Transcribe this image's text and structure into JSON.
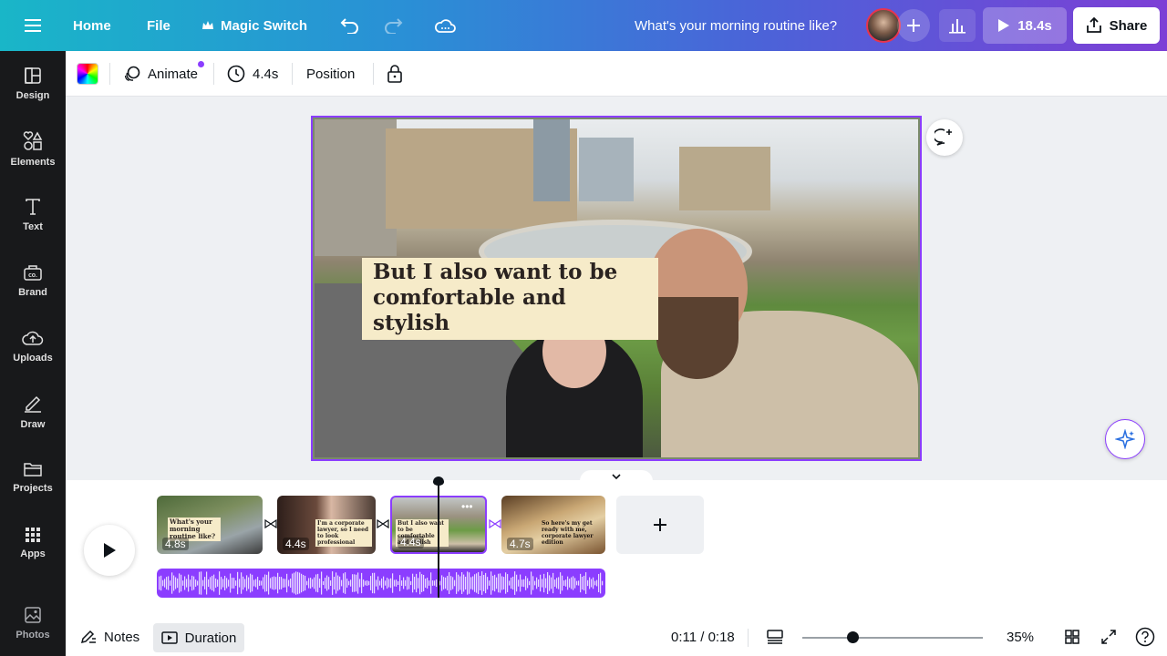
{
  "topbar": {
    "home": "Home",
    "file": "File",
    "magic_switch": "Magic Switch",
    "title": "What's your morning routine like?",
    "play_duration": "18.4s",
    "share": "Share"
  },
  "sidebar": {
    "items": [
      {
        "label": "Design",
        "icon": "design-icon"
      },
      {
        "label": "Elements",
        "icon": "elements-icon"
      },
      {
        "label": "Text",
        "icon": "text-icon"
      },
      {
        "label": "Brand",
        "icon": "brand-icon"
      },
      {
        "label": "Uploads",
        "icon": "upload-icon"
      },
      {
        "label": "Draw",
        "icon": "draw-icon"
      },
      {
        "label": "Projects",
        "icon": "folder-icon"
      },
      {
        "label": "Apps",
        "icon": "apps-icon"
      },
      {
        "label": "Photos",
        "icon": "photo-icon"
      }
    ]
  },
  "toolbar": {
    "animate": "Animate",
    "duration": "4.4s",
    "position": "Position"
  },
  "canvas": {
    "caption_line1": "But I also want to be",
    "caption_line2": "comfortable and stylish"
  },
  "timeline": {
    "clips": [
      {
        "duration": "4.8s",
        "text": "What's your morning routine like?"
      },
      {
        "duration": "4.4s",
        "text": "I'm a corporate lawyer, so I need to look professional"
      },
      {
        "duration": "4.4s",
        "text": "But I also want to be comfortable and stylish",
        "selected": true
      },
      {
        "duration": "4.7s",
        "text": "So here's my get ready with me, corporate lawyer edition"
      }
    ]
  },
  "footer": {
    "notes": "Notes",
    "duration": "Duration",
    "time": "0:11 / 0:18",
    "zoom": "35%",
    "zoom_level": 0.28
  },
  "colors": {
    "accent": "#8b3dff",
    "sidebar_bg": "#18191b"
  }
}
